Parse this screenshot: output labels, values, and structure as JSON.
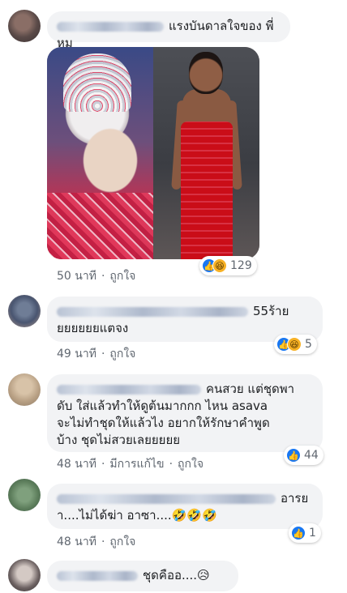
{
  "comments": [
    {
      "text": "แรงบันดาลใจของ พี่หมู",
      "time": "50 นาที",
      "like_label": "ถูกใจ",
      "reaction_count": "129"
    },
    {
      "text_line1": "55ร้าย",
      "text_line2": "ยยยยยยแตจง",
      "time": "49 นาที",
      "like_label": "ถูกใจ",
      "reaction_count": "5"
    },
    {
      "text_line1": "คนสวย แต่ชุดพา",
      "text_line2": "ดับ ใส่แล้วทำให้ดูต้นมากกก ไหน asava",
      "text_line3": "จะไม่ทำชุดให้แล้วไง อยากให้รักษาคำพูด",
      "text_line4": "บ้าง ชุดไม่สวยเลยยยยย",
      "time": "48 นาที",
      "edited_label": "มีการแก้ไข",
      "like_label": "ถูกใจ",
      "reaction_count": "44"
    },
    {
      "text_line1": "อารย",
      "text_line2": "า....ไม่ได้ฆ่า อาซา....🤣🤣🤣",
      "time": "48 นาที",
      "like_label": "ถูกใจ",
      "reaction_count": "1"
    },
    {
      "text": "ชุดคืออ....😥"
    }
  ],
  "separator": "·",
  "colors": {
    "bubble": "#f2f3f5",
    "like_blue": "#1877f2",
    "meta": "#606770"
  },
  "icons": [
    "like-reaction-icon",
    "haha-reaction-icon"
  ]
}
